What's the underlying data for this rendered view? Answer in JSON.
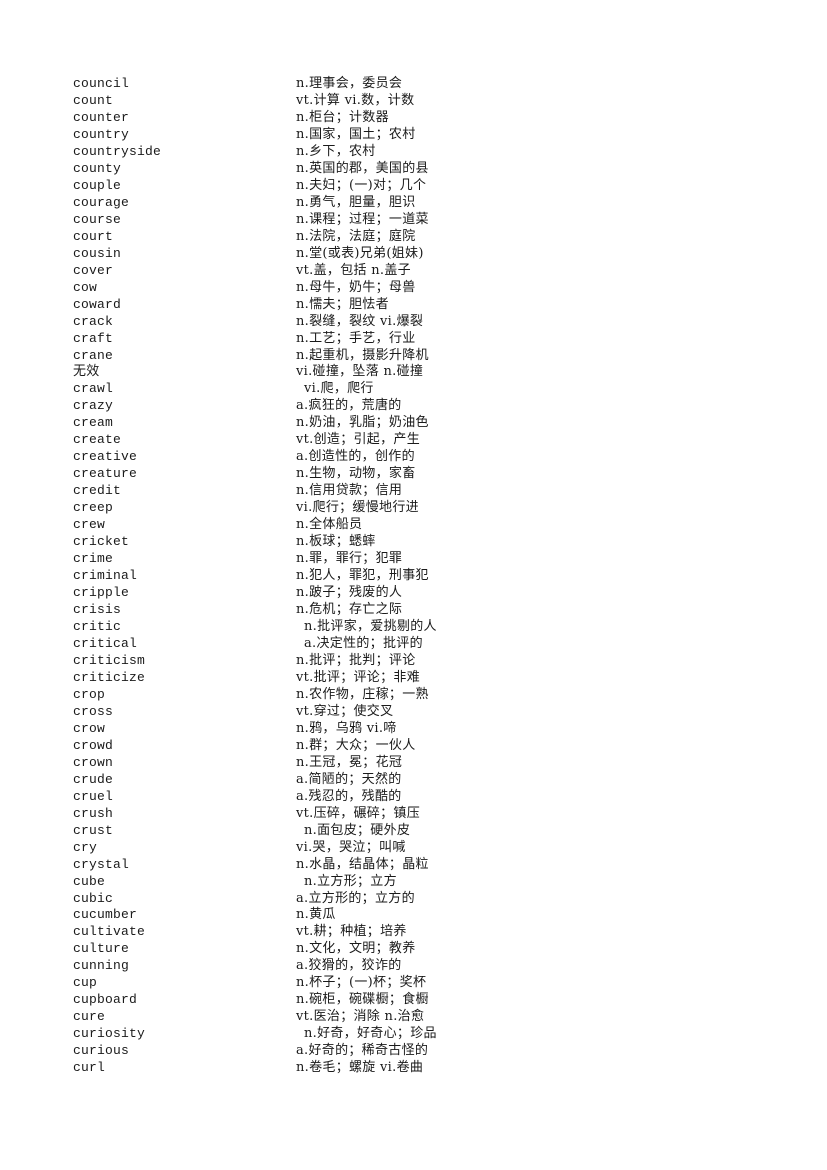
{
  "vocabulary": [
    {
      "word": "council",
      "definition": "n.理事会，委员会"
    },
    {
      "word": "count",
      "definition": "vt.计算 vi.数，计数"
    },
    {
      "word": "counter",
      "definition": "n.柜台；计数器"
    },
    {
      "word": "country",
      "definition": "n.国家，国土；农村"
    },
    {
      "word": "countryside",
      "definition": "n.乡下，农村"
    },
    {
      "word": "county",
      "definition": "n.英国的郡，美国的县"
    },
    {
      "word": "couple",
      "definition": "n.夫妇；(一)对；几个"
    },
    {
      "word": "courage",
      "definition": "n.勇气，胆量，胆识"
    },
    {
      "word": "course",
      "definition": "n.课程；过程；一道菜"
    },
    {
      "word": "court",
      "definition": "n.法院，法庭；庭院"
    },
    {
      "word": "cousin",
      "definition": "n.堂(或表)兄弟(姐妹)"
    },
    {
      "word": "cover",
      "definition": "vt.盖，包括 n.盖子"
    },
    {
      "word": "cow",
      "definition": "n.母牛，奶牛；母兽"
    },
    {
      "word": "coward",
      "definition": "n.懦夫；胆怯者"
    },
    {
      "word": "crack",
      "definition": "n.裂缝，裂纹 vi.爆裂"
    },
    {
      "word": "craft",
      "definition": "n.工艺；手艺，行业"
    },
    {
      "word": "crane",
      "definition": "n.起重机，摄影升降机"
    },
    {
      "word": "无效",
      "definition": "vi.碰撞，坠落 n.碰撞"
    },
    {
      "word": "crawl",
      "definition": "vi.爬，爬行",
      "indent": 1
    },
    {
      "word": "crazy",
      "definition": "a.疯狂的，荒唐的"
    },
    {
      "word": "cream",
      "definition": "n.奶油，乳脂；奶油色"
    },
    {
      "word": "create",
      "definition": "vt.创造；引起，产生"
    },
    {
      "word": "creative",
      "definition": "a.创造性的，创作的"
    },
    {
      "word": "creature",
      "definition": "n.生物，动物，家畜"
    },
    {
      "word": "credit",
      "definition": "n.信用贷款；信用"
    },
    {
      "word": "creep",
      "definition": "vi.爬行；缓慢地行进"
    },
    {
      "word": "crew",
      "definition": "n.全体船员"
    },
    {
      "word": "cricket",
      "definition": "n.板球；蟋蟀"
    },
    {
      "word": "crime",
      "definition": "n.罪，罪行；犯罪"
    },
    {
      "word": "criminal",
      "definition": "n.犯人，罪犯，刑事犯"
    },
    {
      "word": "cripple",
      "definition": "n.跛子；残废的人"
    },
    {
      "word": "crisis",
      "definition": "n.危机；存亡之际"
    },
    {
      "word": "critic",
      "definition": "n.批评家，爱挑剔的人",
      "indent": 1
    },
    {
      "word": "critical",
      "definition": "a.决定性的；批评的",
      "indent": 1
    },
    {
      "word": "criticism",
      "definition": "n.批评；批判；评论"
    },
    {
      "word": "criticize",
      "definition": "vt.批评；评论；非难"
    },
    {
      "word": "crop",
      "definition": "n.农作物，庄稼；一熟"
    },
    {
      "word": "cross",
      "definition": "vt.穿过；使交叉"
    },
    {
      "word": "crow",
      "definition": "n.鸦，乌鸦 vi.啼"
    },
    {
      "word": "crowd",
      "definition": "n.群；大众；一伙人"
    },
    {
      "word": "crown",
      "definition": "n.王冠，冕；花冠"
    },
    {
      "word": "crude",
      "definition": "a.简陋的；天然的"
    },
    {
      "word": "cruel",
      "definition": "a.残忍的，残酷的"
    },
    {
      "word": "crush",
      "definition": "vt.压碎，碾碎；镇压"
    },
    {
      "word": "crust",
      "definition": "n.面包皮；硬外皮",
      "indent": 1
    },
    {
      "word": "cry",
      "definition": "vi.哭，哭泣；叫喊"
    },
    {
      "word": "crystal",
      "definition": "n.水晶，结晶体；晶粒"
    },
    {
      "word": "cube",
      "definition": "n.立方形；立方",
      "indent": 1
    },
    {
      "word": "cubic",
      "definition": "a.立方形的；立方的"
    },
    {
      "word": "cucumber",
      "definition": "n.黄瓜"
    },
    {
      "word": "cultivate",
      "definition": "vt.耕；种植；培养"
    },
    {
      "word": "culture",
      "definition": "n.文化，文明；教养"
    },
    {
      "word": "cunning",
      "definition": "a.狡猾的，狡诈的"
    },
    {
      "word": "cup",
      "definition": "n.杯子；(一)杯；奖杯"
    },
    {
      "word": "cupboard",
      "definition": "n.碗柜，碗碟橱；食橱"
    },
    {
      "word": "cure",
      "definition": "vt.医治；消除 n.治愈"
    },
    {
      "word": "curiosity",
      "definition": "n.好奇，好奇心；珍品",
      "indent": 1
    },
    {
      "word": "curious",
      "definition": "a.好奇的；稀奇古怪的"
    },
    {
      "word": "curl",
      "definition": "n.卷毛；螺旋 vi.卷曲"
    }
  ]
}
